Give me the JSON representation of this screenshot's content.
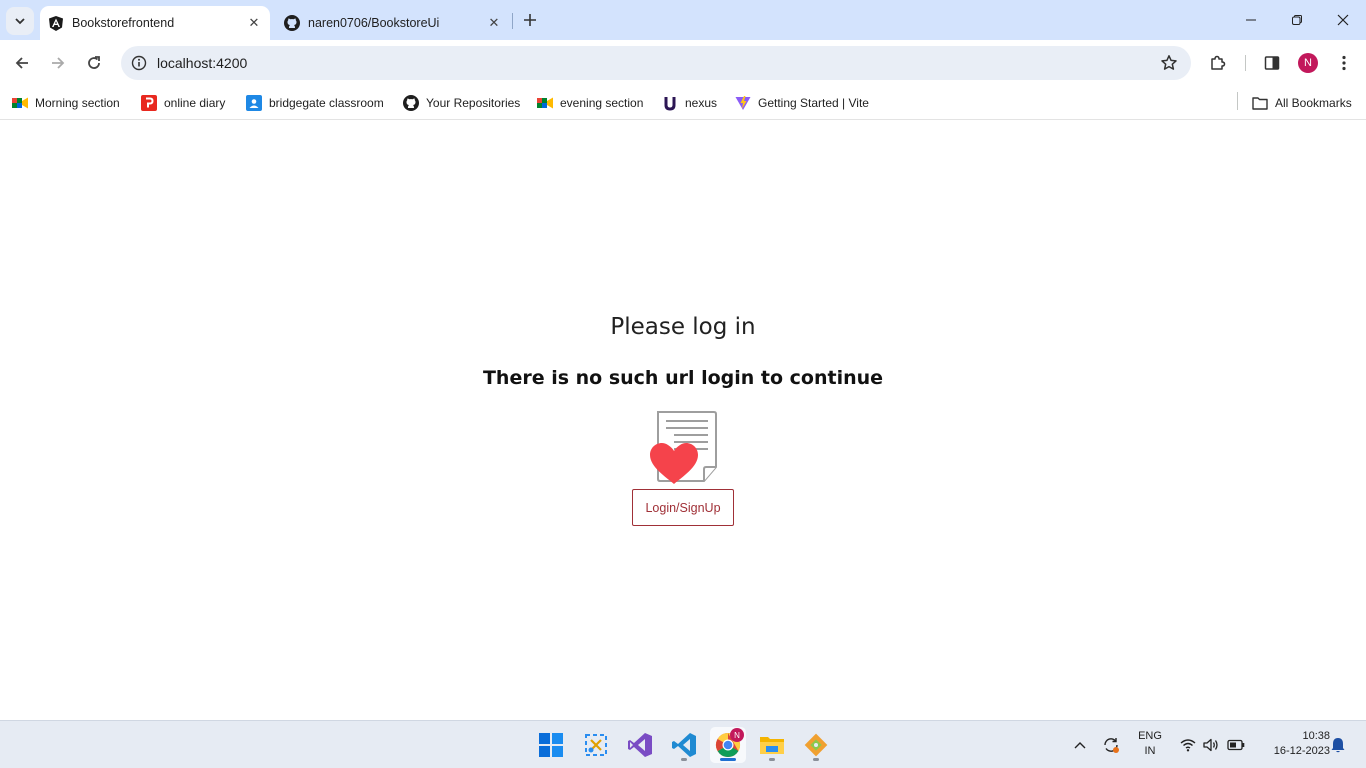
{
  "browser": {
    "tabs": [
      {
        "title": "Bookstorefrontend",
        "favicon": "angular-icon",
        "active": true
      },
      {
        "title": "naren0706/BookstoreUi",
        "favicon": "github-icon",
        "active": false
      }
    ],
    "url": "localhost:4200",
    "profile_initial": "N",
    "profile_color": "#c2185b"
  },
  "bookmarks": {
    "items": [
      {
        "label": "Morning section",
        "icon": "google-meet-icon"
      },
      {
        "label": "online diary",
        "icon": "online-diary-icon"
      },
      {
        "label": "bridgegate classroom",
        "icon": "classroom-icon"
      },
      {
        "label": "Your Repositories",
        "icon": "github-icon"
      },
      {
        "label": "evening section",
        "icon": "google-meet-icon"
      },
      {
        "label": "nexus",
        "icon": "nexus-icon"
      },
      {
        "label": "Getting Started | Vite",
        "icon": "vite-icon"
      }
    ],
    "all_label": "All Bookmarks"
  },
  "page": {
    "title": "Please log in",
    "subtitle": "There is no such url login to continue",
    "button_label": "Login/SignUp",
    "accent_color": "#a03037"
  },
  "taskbar": {
    "apps": [
      "windows-start-icon",
      "snipping-tool-icon",
      "visual-studio-icon",
      "vscode-icon",
      "chrome-icon",
      "file-explorer-icon",
      "git-icon"
    ],
    "chrome_badge": "N",
    "language": [
      "ENG",
      "IN"
    ],
    "time": "10:38",
    "date": "16-12-2023"
  }
}
